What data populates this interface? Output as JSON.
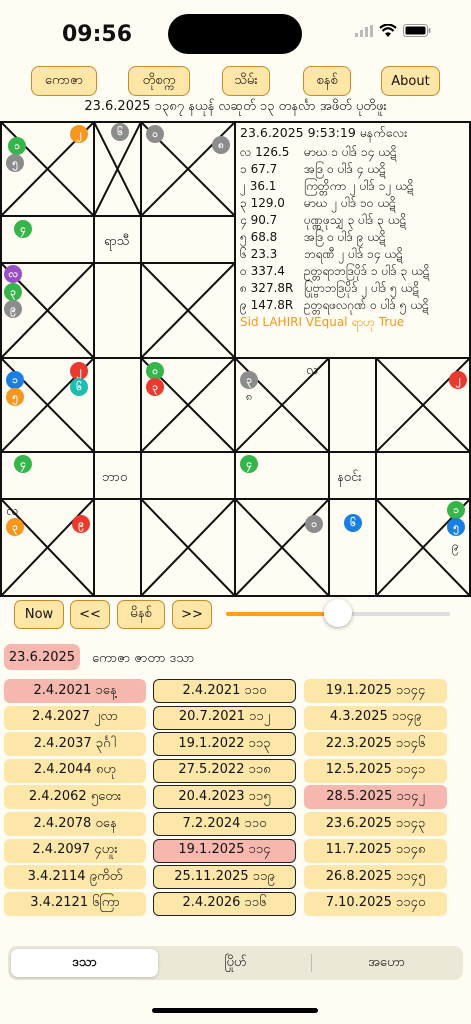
{
  "status": {
    "time": "09:56",
    "battery": "battery-icon",
    "wifi": "wifi-icon",
    "signal": "signal-icon"
  },
  "toolbar": {
    "b1": "ကောဇာ",
    "b2": "တိုစက္က",
    "b3": "သိမ်း",
    "b4": "စနစ်",
    "b5": "About"
  },
  "date_line": "23.6.2025 ၁၃၈၇ နယုန် လဆုတ် ၁၃ တနင်္လာ အဖိတ် ပုတိဖူး",
  "chart": {
    "upper_labels": {
      "left": "ရာသီ"
    },
    "lower_labels": {
      "left": "ဘာဝ",
      "right": "နဝင်း"
    },
    "lower_right_text": "လ",
    "lower_bottomleft_text": "လ",
    "upper_left_dot_label": "၂",
    "info": {
      "header": "23.6.2025 9:53:19 မနက်လေး",
      "rows": [
        {
          "a": "လ 126.5",
          "b": "မာဃ ၁ ပါဒ် ၁၄ ယဋိ"
        },
        {
          "a": "၁ 67.7",
          "b": "အဒြ ၀ ပါဒ် ၄ ယဋိ"
        },
        {
          "a": "၂ 36.1",
          "b": "ကြတ္တိကာ ၂ ပါဒ် ၁၂ ယဋိ"
        },
        {
          "a": "၃ 129.0",
          "b": "မာဃ ၂ ပါဒ် ၁၀ ယဋိ"
        },
        {
          "a": "၄ 90.7",
          "b": "ပုဏ္ဏဖုသျှ ၃ ပါဒ် ၃ ယဋိ"
        },
        {
          "a": "၅ 68.8",
          "b": "အဒြ ၀ ပါဒ် ၉ ယဋိ"
        },
        {
          "a": "၆ 23.3",
          "b": "ဘရဏီ ၂ ပါဒ် ၁၄ ယဋိ"
        },
        {
          "a": "၀ 337.4",
          "b": "ဥတ္တရာဘဒြပိုဒ် ၁ ပါဒ် ၃ ယဋိ"
        },
        {
          "a": "၈ 327.8R",
          "b": "ပြုဗ္ဗာဘဒြပိုဒ် ၂ ပါဒ် ၅ ယဋိ"
        },
        {
          "a": "၉ 147.8R",
          "b": "ဥတ္တရဖလဂုဏ် ၀ ပါဒ် ၅ ယဋိ"
        }
      ],
      "footer": "Sid LAHIRI VEqual ရာဟု True"
    },
    "colors": {
      "orange": "#f5961e",
      "gray": "#8c8c8c",
      "green": "#36b54a",
      "purple": "#9a4fc9",
      "red": "#e83a2e",
      "blue": "#1a7fe0",
      "teal": "#1fbdb0"
    },
    "dots": {
      "u_top_or": "၂",
      "u_top_gray1": "၆",
      "u_top_gray2": "၀",
      "u_top_gray3": "၈",
      "u_l_green": "၁",
      "u_l_gray": "၅",
      "u_l2_green": "၄",
      "u_l3_purple": "လ",
      "u_l3_green": "၃",
      "u_l3_gray": "၉",
      "m_blue": "၁",
      "m_or": "၅",
      "m_red": "၂",
      "m_teal": "၆",
      "m_green": "၀",
      "m_red2": "၃",
      "m_gray": "၃",
      "m_gray_sub": "၈",
      "m_r_red": "၂",
      "l_green1": "၄",
      "l_green2": "၄",
      "b_or": "၃",
      "b_red": "၉",
      "b_gray": "၀",
      "b_blue": "၆",
      "b_r_green": "၁",
      "b_r_teal": "၅",
      "b_r_sub": "၉"
    }
  },
  "controls": {
    "now": "Now",
    "prev": "<<",
    "set": "မိနစ်",
    "next": ">>",
    "slider": 0.5
  },
  "dasa": {
    "date": "23.6.2025",
    "title": "ကောဇာ ဇာတာ ဒသာ",
    "col1": [
      "2.4.2021 ၁နေ့",
      "2.4.2027 ၂လာ",
      "2.4.2037 ၃င်္ဂါ",
      "2.4.2044 ၈ဟု",
      "2.4.2062 ၅တေး",
      "2.4.2078 ၀နေ",
      "2.4.2097 ၄ဟူး",
      "3.4.2114 ၉ကိတ်",
      "3.4.2121 ၆ကြာ"
    ],
    "col2": [
      "2.4.2021 ၁၁၀",
      "20.7.2021 ၁၁၂",
      "19.1.2022 ၁၁၃",
      "27.5.2022 ၁၁၈",
      "20.4.2023 ၁၁၅",
      "7.2.2024 ၁၁၀",
      "19.1.2025 ၁၁၄",
      "25.11.2025 ၁၁၉",
      "2.4.2026 ၁၁၆"
    ],
    "col3": [
      "19.1.2025 ၁၁၄၄",
      "4.3.2025 ၁၁၄၉",
      "22.3.2025 ၁၁၄၆",
      "12.5.2025 ၁၁၄၁",
      "28.5.2025 ၁၁၄၂",
      "23.6.2025 ၁၁၄၃",
      "11.7.2025 ၁၁၄၈",
      "26.8.2025 ၁၁၄၅",
      "7.10.2025 ၁၁၄၀"
    ]
  },
  "tabs": {
    "t1": "ဒသာ",
    "t2": "ပြိုဟ်",
    "t3": "အဟော"
  }
}
